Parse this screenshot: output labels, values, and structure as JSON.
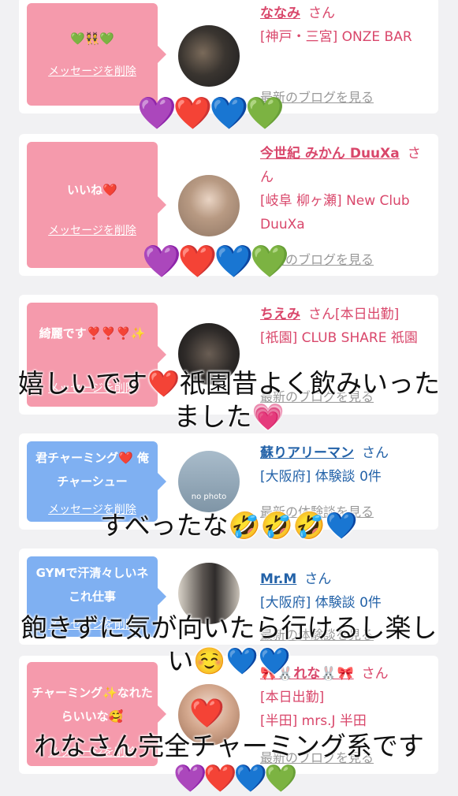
{
  "cards": [
    {
      "bubble_text": "💚👯💚",
      "delete_label": "メッセージを削除",
      "name": "ななみ",
      "san": "さん",
      "location": "[神戸・三宮] ONZE BAR",
      "more": "最新のブログを見る"
    },
    {
      "bubble_text": "いいね❤️",
      "delete_label": "メッセージを削除",
      "name": "今世紀 みかん DuuXa",
      "san": "さん",
      "location": "[岐阜 柳ヶ瀬] New Club DuuXa",
      "more": "最新のブログを見る"
    },
    {
      "bubble_text": "綺麗です❣️❣️❣️✨",
      "delete_label": "メッセージを削除",
      "name": "ちえみ",
      "san": "さん[本日出勤]",
      "location": "[祇園] CLUB SHARE 祇園",
      "more": "最新のブログを見る"
    },
    {
      "bubble_text": "君チャーミング❤️ 俺チャーシュー",
      "delete_label": "メッセージを削除",
      "name": "蘇りアリーマン",
      "san": "さん",
      "location": "[大阪府] 体験談 0件",
      "more": "最新の体験談を見る",
      "avatar_placeholder": "no photo"
    },
    {
      "bubble_text": "GYMで汗清々しいネ これ仕事",
      "delete_label": "メッセージを削除",
      "name": "Mr.M",
      "san": "さん",
      "location": "[大阪府] 体験談 0件",
      "more": "最新の体験談を見る"
    },
    {
      "bubble_text": "チャーミング✨なれたらいいな🥰",
      "delete_label": "メッセージを削除",
      "name": "🎀🐰れな🐰🎀",
      "san": "さん",
      "status": "[本日出勤]",
      "location": "[半田] mrs.J 半田",
      "more": "最新のブログを見る"
    }
  ],
  "overlays": {
    "hearts": "💜❤️💙💚",
    "caption1": "嬉しいです❤️祇園昔よく飲みいったました💗",
    "caption2": "すべったな🤣🤣🤣💙",
    "caption3": "飽きずに気が向いたら行けるし楽しい☺️💙💙",
    "caption4": "れなさん完全チャーミング系です",
    "sticker_heart": "❤️"
  },
  "colors": {
    "pink_bubble": "#f59aac",
    "blue_bubble": "#7fb0f2",
    "pink_text": "#d9476b",
    "blue_text": "#2362a8"
  }
}
